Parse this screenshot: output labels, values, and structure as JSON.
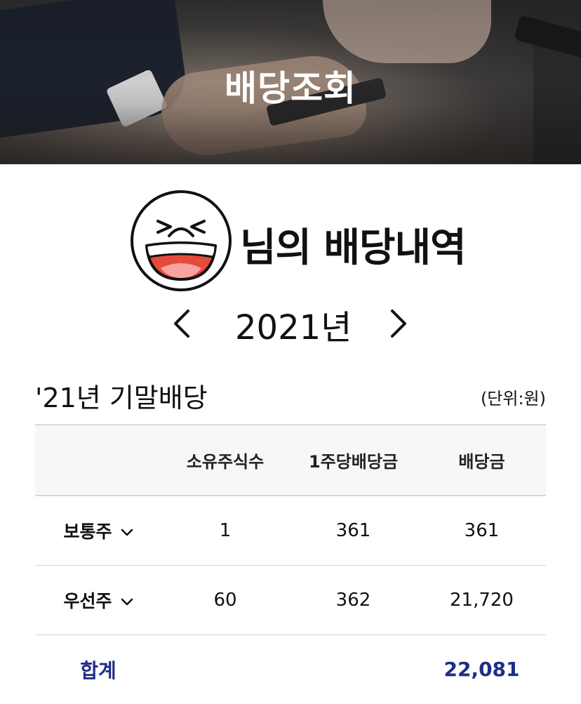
{
  "header": {
    "title": "배당조회"
  },
  "profile": {
    "heading": "님의 배당내역",
    "avatar": "laughing-face-emoji"
  },
  "year_nav": {
    "year": "2021년",
    "prev_icon": "chevron-left-icon",
    "next_icon": "chevron-right-icon"
  },
  "section": {
    "title": "'21년 기말배당",
    "unit": "(단위:원)"
  },
  "table": {
    "columns": [
      "",
      "소유주식수",
      "1주당배당금",
      "배당금"
    ],
    "rows": [
      {
        "type": "보통주",
        "shares": "1",
        "per_share": "361",
        "dividend": "361"
      },
      {
        "type": "우선주",
        "shares": "60",
        "per_share": "362",
        "dividend": "21,720"
      }
    ],
    "total": {
      "label": "합계",
      "dividend": "22,081"
    }
  },
  "colors": {
    "accent_navy": "#1f2d86",
    "header_bg": "#f7f7f7",
    "emoji_mouth": "#e64a3b"
  }
}
